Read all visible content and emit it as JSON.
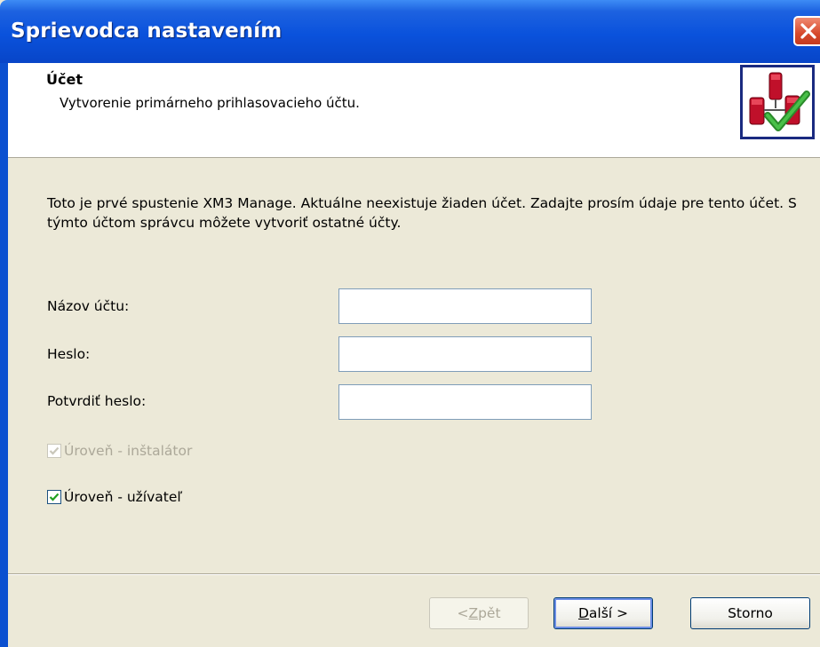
{
  "window": {
    "title": "Sprievodca nastavením"
  },
  "header": {
    "title": "Účet",
    "subtitle": "Vytvorenie primárneho prihlasovacieho účtu.",
    "icon": "users-check-icon"
  },
  "intro": {
    "text": "Toto je prvé spustenie XM3 Manage. Aktuálne neexistuje žiaden účet. Zadajte prosím údaje pre tento účet. S týmto účtom správcu môžete vytvoriť ostatné účty."
  },
  "form": {
    "account_name_label": "Názov účtu:",
    "account_name_value": "",
    "password_label": "Heslo:",
    "password_value": "",
    "confirm_password_label": "Potvrdiť heslo:",
    "confirm_password_value": "",
    "installer_level_label": "Úroveň - inštalátor",
    "installer_level_checked": true,
    "installer_level_enabled": false,
    "user_level_label": "Úroveň - užívateľ",
    "user_level_checked": true
  },
  "buttons": {
    "back": {
      "mnemonic": "Z",
      "rest": "pět",
      "prefix": "< ",
      "enabled": false
    },
    "next": {
      "mnemonic": "D",
      "rest": "alší >",
      "enabled": true
    },
    "cancel": {
      "label": "Storno",
      "enabled": true
    }
  },
  "colors": {
    "titlebar": "#0a52dc",
    "dialog_bg": "#ece9d8",
    "close_button": "#d6492b",
    "check": "#2fa02f",
    "disabled_text": "#aca899"
  }
}
